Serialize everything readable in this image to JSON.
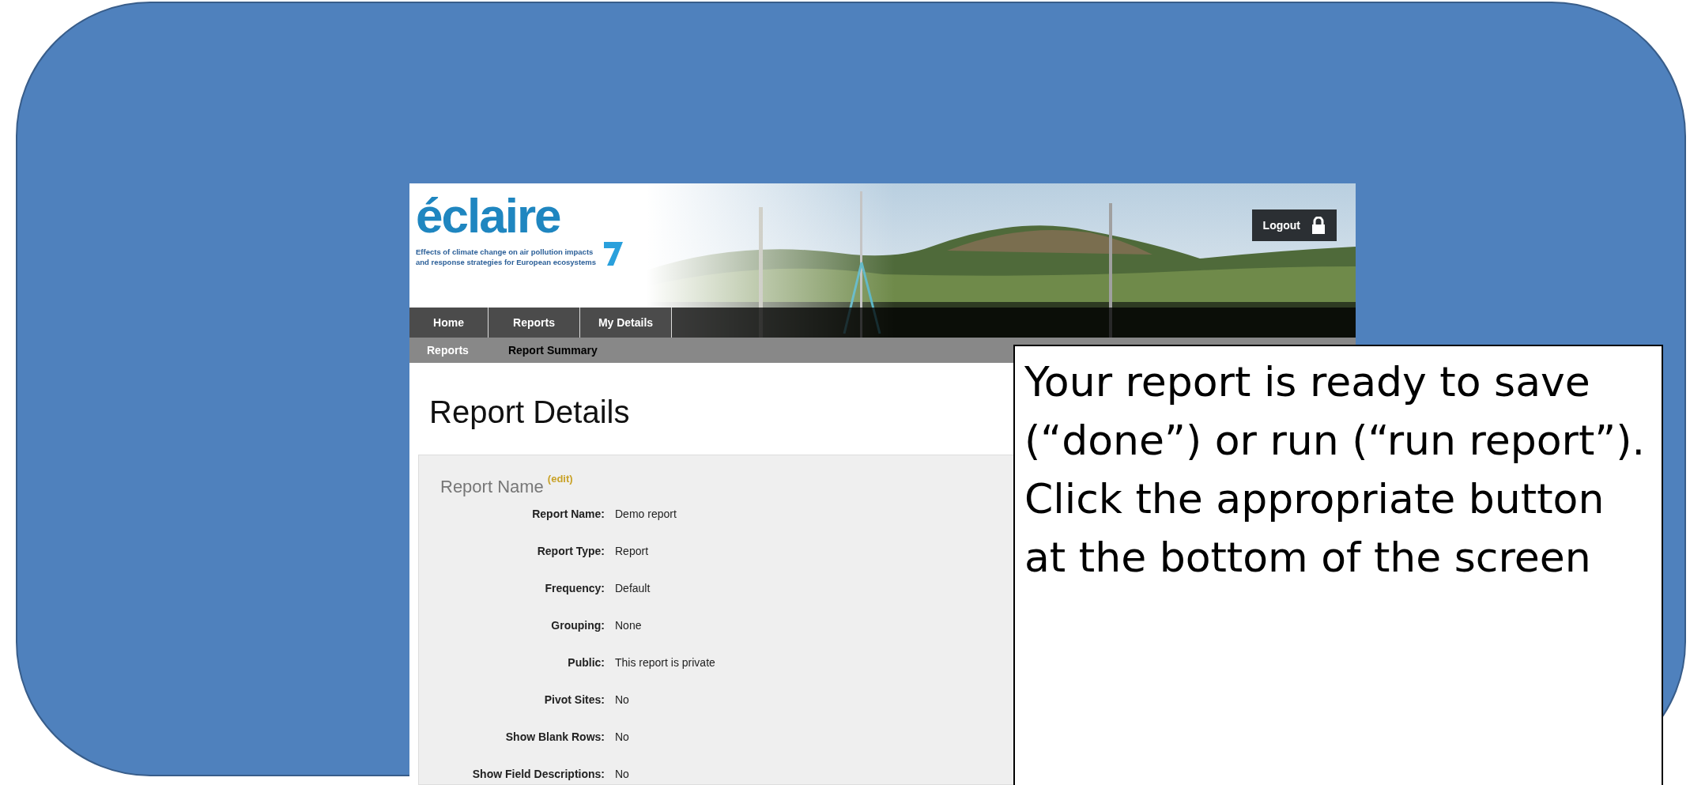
{
  "header": {
    "logo": "éclaire",
    "tagline": [
      "Effects of climate change on air pollution impacts",
      "and response strategies for European ecosystems"
    ],
    "logout": "Logout"
  },
  "nav": [
    {
      "label": "Home"
    },
    {
      "label": "Reports"
    },
    {
      "label": "My Details"
    }
  ],
  "subnav": [
    {
      "label": "Reports",
      "selected": true
    },
    {
      "label": "Report Summary",
      "selected": false
    }
  ],
  "page_title": "Report Details",
  "section": {
    "title": "Report Name",
    "edit_link": "(edit)",
    "fields": [
      {
        "label": "Report Name:",
        "value": "Demo report"
      },
      {
        "label": "Report Type:",
        "value": "Report"
      },
      {
        "label": "Frequency:",
        "value": "Default"
      },
      {
        "label": "Grouping:",
        "value": "None"
      },
      {
        "label": "Public:",
        "value": "This report is private"
      },
      {
        "label": "Pivot Sites:",
        "value": "No"
      },
      {
        "label": "Show Blank Rows:",
        "value": "No"
      },
      {
        "label": "Show Field Descriptions:",
        "value": "No"
      }
    ]
  },
  "callout": {
    "paragraphs": [
      "Your report is ready to save (“done”) or run (“run report”).",
      "Click the appropriate button at the bottom of the screen"
    ]
  }
}
